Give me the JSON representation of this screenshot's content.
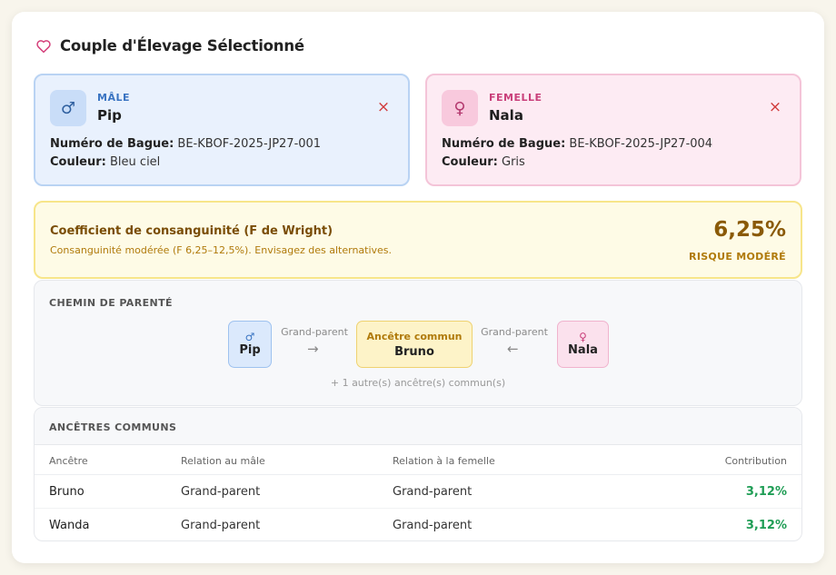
{
  "header": {
    "title": "Couple d'Élevage Sélectionné",
    "icon": "heart-icon"
  },
  "male": {
    "sex_label": "MÂLE",
    "symbol": "♂",
    "name": "Pip",
    "ring_label": "Numéro de Bague:",
    "ring_value": "BE-KBOF-2025-JP27-001",
    "color_label": "Couleur:",
    "color_value": "Bleu ciel",
    "remove_icon": "×"
  },
  "female": {
    "sex_label": "FEMELLE",
    "symbol": "♀",
    "name": "Nala",
    "ring_label": "Numéro de Bague:",
    "ring_value": "BE-KBOF-2025-JP27-004",
    "color_label": "Couleur:",
    "color_value": "Gris",
    "remove_icon": "×"
  },
  "coefficient": {
    "title": "Coefficient de consanguinité (F de Wright)",
    "subtitle": "Consanguinité modérée (F 6,25–12,5%). Envisagez des alternatives.",
    "value": "6,25%",
    "risk": "RISQUE MODÉRÉ"
  },
  "path": {
    "label": "CHEMIN DE PARENTÉ",
    "male_symbol": "♂",
    "male_name": "Pip",
    "left_relation": "Grand-parent",
    "left_arrow": "→",
    "ancestor_caption": "Ancêtre commun",
    "ancestor_name": "Bruno",
    "right_relation": "Grand-parent",
    "right_arrow": "←",
    "female_symbol": "♀",
    "female_name": "Nala",
    "more": "+ 1 autre(s) ancêtre(s) commun(s)"
  },
  "ancestors": {
    "label": "ANCÊTRES COMMUNS",
    "columns": [
      "Ancêtre",
      "Relation au mâle",
      "Relation à la femelle",
      "Contribution"
    ],
    "rows": [
      {
        "ancestor": "Bruno",
        "male_rel": "Grand-parent",
        "female_rel": "Grand-parent",
        "contribution": "3,12%"
      },
      {
        "ancestor": "Wanda",
        "male_rel": "Grand-parent",
        "female_rel": "Grand-parent",
        "contribution": "3,12%"
      }
    ]
  },
  "colors": {
    "male_accent": "#3a74c2",
    "female_accent": "#c93f7a",
    "warning": "#8a5a07",
    "positive": "#1f9d55",
    "remove": "#d13b3b"
  }
}
